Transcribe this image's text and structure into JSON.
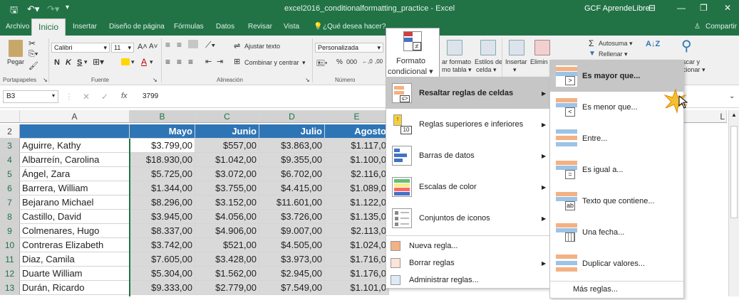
{
  "titlebar": {
    "save_icon": "save-icon",
    "undo_icon": "undo-icon",
    "redo_icon": "redo-icon",
    "doc_title": "excel2016_conditionalformatting_practice - Excel",
    "brand": "GCF AprendeLibre"
  },
  "tabs": [
    "Archivo",
    "Inicio",
    "Insertar",
    "Diseño de página",
    "Fórmulas",
    "Datos",
    "Revisar",
    "Vista"
  ],
  "tell_me": "¿Qué desea hacer?",
  "share": "Compartir",
  "ribbon": {
    "paste": "Pegar",
    "group_clipboard": "Portapapeles",
    "font_name": "Calibri",
    "font_size": "11",
    "bold": "N",
    "italic": "K",
    "underline": "S",
    "group_font": "Fuente",
    "wrap_text": "Ajustar texto",
    "merge_center": "Combinar y centrar",
    "group_alignment": "Alineación",
    "number_format": "Personalizada",
    "group_number": "Número",
    "conditional_format_1": "Formato",
    "conditional_format_2": "condicional",
    "format_table": "ar formato",
    "format_table_2": "mo tabla",
    "cell_styles": "Estilos de",
    "cell_styles_2": "celda",
    "insert": "Insertar",
    "delete": "Elimin",
    "autosum": "Autosuma",
    "fill": "Rellenar",
    "find_1": "scar y",
    "find_2": "cionar"
  },
  "formula": {
    "cell_ref": "B3",
    "value": "3799"
  },
  "grid": {
    "columns": [
      "A",
      "B",
      "C",
      "D",
      "E"
    ],
    "extra_col": "L",
    "rows": [
      "2",
      "3",
      "4",
      "5",
      "6",
      "7",
      "8",
      "9",
      "10",
      "11",
      "12",
      "13"
    ],
    "headers": [
      "",
      "Mayo",
      "Junio",
      "Julio",
      "Agosto"
    ],
    "data": [
      [
        "Aguirre, Kathy",
        "$3.799,00",
        "$557,00",
        "$3.863,00",
        "$1.117,0"
      ],
      [
        "Albarreín, Carolina",
        "$18.930,00",
        "$1.042,00",
        "$9.355,00",
        "$1.100,0"
      ],
      [
        "Ángel, Zara",
        "$5.725,00",
        "$3.072,00",
        "$6.702,00",
        "$2.116,0"
      ],
      [
        "Barrera, William",
        "$1.344,00",
        "$3.755,00",
        "$4.415,00",
        "$1.089,0"
      ],
      [
        "Bejarano Michael",
        "$8.296,00",
        "$3.152,00",
        "$11.601,00",
        "$1.122,0"
      ],
      [
        "Castillo, David",
        "$3.945,00",
        "$4.056,00",
        "$3.726,00",
        "$1.135,0"
      ],
      [
        "Colmenares, Hugo",
        "$8.337,00",
        "$4.906,00",
        "$9.007,00",
        "$2.113,0"
      ],
      [
        "Contreras Elizabeth",
        "$3.742,00",
        "$521,00",
        "$4.505,00",
        "$1.024,0"
      ],
      [
        "Diaz, Camila",
        "$7.605,00",
        "$3.428,00",
        "$3.973,00",
        "$1.716,0"
      ],
      [
        "Duarte William",
        "$5.304,00",
        "$1.562,00",
        "$2.945,00",
        "$1.176,0"
      ],
      [
        "Durán, Ricardo",
        "$9.333,00",
        "$2.779,00",
        "$7.549,00",
        "$1.101,0"
      ]
    ]
  },
  "menu1": {
    "items": [
      {
        "label": "Resaltar reglas de celdas",
        "icon": "highlight-rules-icon"
      },
      {
        "label": "Reglas superiores e inferiores",
        "icon": "top-bottom-rules-icon"
      },
      {
        "label": "Barras de datos",
        "icon": "data-bars-icon"
      },
      {
        "label": "Escalas de color",
        "icon": "color-scales-icon"
      },
      {
        "label": "Conjuntos de iconos",
        "icon": "icon-sets-icon"
      }
    ],
    "simple": [
      "Nueva regla...",
      "Borrar reglas",
      "Administrar reglas..."
    ]
  },
  "menu2": {
    "items": [
      {
        "label": "Es mayor que...",
        "symbol": ">"
      },
      {
        "label": "Es menor que...",
        "symbol": "<"
      },
      {
        "label": "Entre...",
        "symbol": ""
      },
      {
        "label": "Es igual a...",
        "symbol": "="
      },
      {
        "label": "Texto que contiene...",
        "symbol": "ab"
      },
      {
        "label": "Una fecha...",
        "symbol": ""
      },
      {
        "label": "Duplicar valores...",
        "symbol": ""
      }
    ],
    "more": "Más reglas..."
  },
  "colors": {
    "excel_green": "#217346",
    "header_blue": "#2e75b6",
    "selection_gray": "#d9d9d9"
  }
}
